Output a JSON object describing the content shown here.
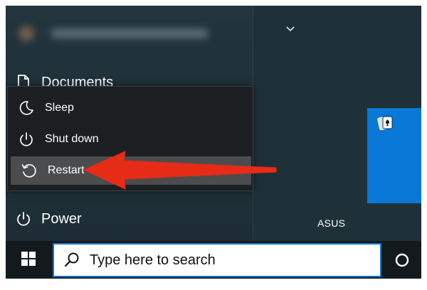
{
  "start_menu": {
    "documents_label": "Documents",
    "power_label": "Power"
  },
  "power_menu": {
    "sleep_label": "Sleep",
    "shutdown_label": "Shut down",
    "restart_label": "Restart"
  },
  "tiles": {
    "tile_label": "ASUS"
  },
  "taskbar": {
    "search_placeholder": "Type here to search"
  },
  "colors": {
    "accent": "#0a78d6",
    "arrow": "#e62b17",
    "menu_bg": "#1f3038",
    "flyout_bg": "#1b1f21",
    "highlight": "#4a4c4e"
  },
  "icons": [
    "document-icon",
    "power-icon",
    "sleep-moon-icon",
    "restart-icon",
    "windows-logo-icon",
    "search-icon",
    "cortana-circle-icon",
    "chevron-down-icon",
    "solitaire-cards-icon"
  ]
}
